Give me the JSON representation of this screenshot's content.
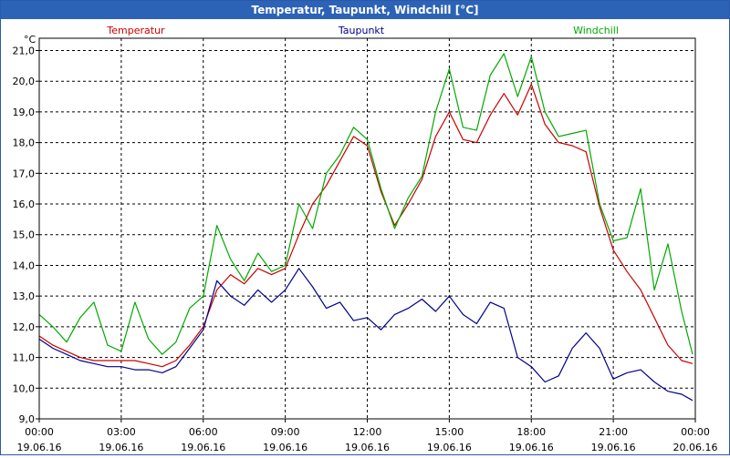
{
  "window_title": "Temperatur, Taupunkt, Windchill [°C]",
  "chart_data": {
    "type": "line",
    "title": "Temperatur, Taupunkt, Windchill [°C]",
    "ylabel": "°C",
    "ylim": [
      9.0,
      21.4
    ],
    "yticks": [
      "9,0",
      "10,0",
      "11,0",
      "12,0",
      "13,0",
      "14,0",
      "15,0",
      "16,0",
      "17,0",
      "18,0",
      "19,0",
      "20,0",
      "21,0"
    ],
    "xlim": [
      0,
      24
    ],
    "xticks": [
      {
        "time": "00:00",
        "date": "19.06.16"
      },
      {
        "time": "03:00",
        "date": "19.06.16"
      },
      {
        "time": "06:00",
        "date": "19.06.16"
      },
      {
        "time": "09:00",
        "date": "19.06.16"
      },
      {
        "time": "12:00",
        "date": "19.06.16"
      },
      {
        "time": "15:00",
        "date": "19.06.16"
      },
      {
        "time": "18:00",
        "date": "19.06.16"
      },
      {
        "time": "21:00",
        "date": "19.06.16"
      },
      {
        "time": "00:00",
        "date": "20.06.16"
      }
    ],
    "grid": true,
    "legend": "top",
    "series": [
      {
        "name": "Temperatur",
        "color": "#cc0000",
        "x": [
          0,
          0.5,
          1,
          1.5,
          2,
          2.5,
          3,
          3.5,
          4,
          4.5,
          5,
          5.5,
          6,
          6.5,
          7,
          7.5,
          8,
          8.5,
          9,
          9.5,
          10,
          10.5,
          11,
          11.5,
          12,
          12.5,
          13,
          13.5,
          14,
          14.5,
          15,
          15.5,
          16,
          16.5,
          17,
          17.5,
          18,
          18.5,
          19,
          19.5,
          20,
          20.5,
          21,
          21.5,
          22,
          22.5,
          23,
          23.5,
          23.9
        ],
        "values": [
          11.7,
          11.4,
          11.2,
          11.0,
          10.9,
          10.9,
          10.9,
          10.9,
          10.8,
          10.7,
          10.9,
          11.4,
          12.0,
          13.2,
          13.7,
          13.4,
          13.9,
          13.7,
          13.9,
          15.0,
          16.0,
          16.6,
          17.4,
          18.2,
          17.9,
          16.4,
          15.3,
          16.0,
          16.8,
          18.2,
          19.0,
          18.1,
          18.0,
          18.9,
          19.6,
          18.9,
          19.9,
          18.6,
          18.0,
          17.9,
          17.7,
          15.9,
          14.5,
          13.8,
          13.2,
          12.3,
          11.4,
          10.9,
          10.8
        ]
      },
      {
        "name": "Taupunkt",
        "color": "#00008b",
        "x": [
          0,
          0.5,
          1,
          1.5,
          2,
          2.5,
          3,
          3.5,
          4,
          4.5,
          5,
          5.5,
          6,
          6.5,
          7,
          7.5,
          8,
          8.5,
          9,
          9.5,
          10,
          10.5,
          11,
          11.5,
          12,
          12.5,
          13,
          13.5,
          14,
          14.5,
          15,
          15.5,
          16,
          16.5,
          17,
          17.5,
          18,
          18.5,
          19,
          19.5,
          20,
          20.5,
          21,
          21.5,
          22,
          22.5,
          23,
          23.5,
          23.9
        ],
        "values": [
          11.6,
          11.3,
          11.1,
          10.9,
          10.8,
          10.7,
          10.7,
          10.6,
          10.6,
          10.5,
          10.7,
          11.3,
          11.9,
          13.5,
          13.0,
          12.7,
          13.2,
          12.8,
          13.2,
          13.9,
          13.3,
          12.6,
          12.8,
          12.2,
          12.3,
          11.9,
          12.4,
          12.6,
          12.9,
          12.5,
          13.0,
          12.4,
          12.1,
          12.8,
          12.6,
          11.0,
          10.7,
          10.2,
          10.4,
          11.3,
          11.8,
          11.3,
          10.3,
          10.5,
          10.6,
          10.2,
          9.9,
          9.8,
          9.6
        ]
      },
      {
        "name": "Windchill",
        "color": "#00aa00",
        "x": [
          0,
          0.5,
          1,
          1.5,
          2,
          2.5,
          3,
          3.5,
          4,
          4.5,
          5,
          5.5,
          6,
          6.5,
          7,
          7.5,
          8,
          8.5,
          9,
          9.5,
          10,
          10.5,
          11,
          11.5,
          12,
          12.5,
          13,
          13.5,
          14,
          14.5,
          15,
          15.5,
          16,
          16.5,
          17,
          17.5,
          18,
          18.5,
          19,
          19.5,
          20,
          20.5,
          21,
          21.5,
          22,
          22.5,
          23,
          23.5,
          23.9
        ],
        "values": [
          12.4,
          12.0,
          11.5,
          12.3,
          12.8,
          11.4,
          11.2,
          12.8,
          11.6,
          11.1,
          11.5,
          12.6,
          13.0,
          15.3,
          14.2,
          13.5,
          14.4,
          13.8,
          14.0,
          16.0,
          15.2,
          17.0,
          17.6,
          18.5,
          18.1,
          16.5,
          15.2,
          16.2,
          16.9,
          19.0,
          20.4,
          18.5,
          18.4,
          20.2,
          20.9,
          19.5,
          20.8,
          19.0,
          18.2,
          18.3,
          18.4,
          16.0,
          14.8,
          14.9,
          16.5,
          13.2,
          14.7,
          12.5,
          11.1
        ]
      }
    ]
  }
}
